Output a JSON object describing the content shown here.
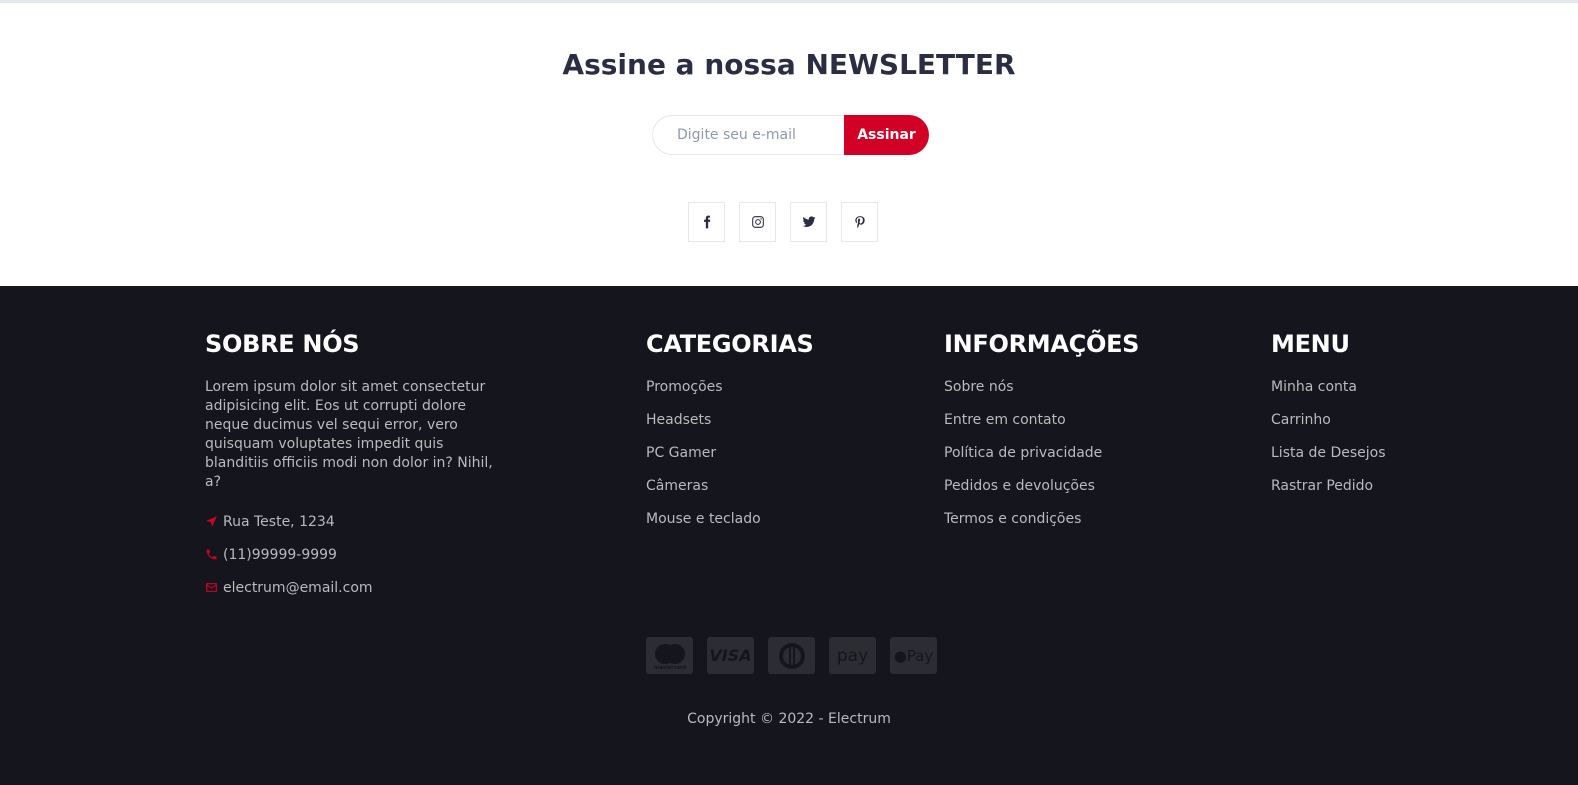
{
  "newsletter": {
    "title": "Assine a nossa NEWSLETTER",
    "email_placeholder": "Digite seu e-mail",
    "subscribe_label": "Assinar",
    "social_icons": [
      "facebook-icon",
      "instagram-icon",
      "twitter-icon",
      "pinterest-icon"
    ]
  },
  "footer": {
    "about": {
      "heading": "SOBRE NÓS",
      "text": "Lorem ipsum dolor sit amet consectetur adipisicing elit. Eos ut corrupti dolore neque ducimus vel sequi error, vero quisquam voluptates impedit quis blanditiis officiis modi non dolor in? Nihil, a?",
      "address": "Rua Teste, 1234",
      "phone": "(11)99999-9999",
      "email": "electrum@email.com"
    },
    "categories": {
      "heading": "CATEGORIAS",
      "items": [
        "Promoções",
        "Headsets",
        "PC Gamer",
        "Câmeras",
        "Mouse e teclado"
      ]
    },
    "information": {
      "heading": "INFORMAÇÕES",
      "items": [
        "Sobre nós",
        "Entre em contato",
        "Política de privacidade",
        "Pedidos e devoluções",
        "Termos e condições"
      ]
    },
    "menu": {
      "heading": "MENU",
      "items": [
        "Minha conta",
        "Carrinho",
        "Lista de Desejos",
        "Rastrar Pedido"
      ]
    },
    "payments": [
      "mastercard-icon",
      "visa-icon",
      "diners-icon",
      "amazon-pay-icon",
      "apple-pay-icon"
    ],
    "payment_labels": [
      "mastercard",
      "VISA",
      "",
      "pay",
      "Pay"
    ],
    "copyright": "Copyright © 2022 - Electrum"
  },
  "colors": {
    "accent": "#d10024",
    "footer_bg": "#15161d",
    "text_dark": "#2b2d42",
    "footer_text": "#b9babc"
  }
}
